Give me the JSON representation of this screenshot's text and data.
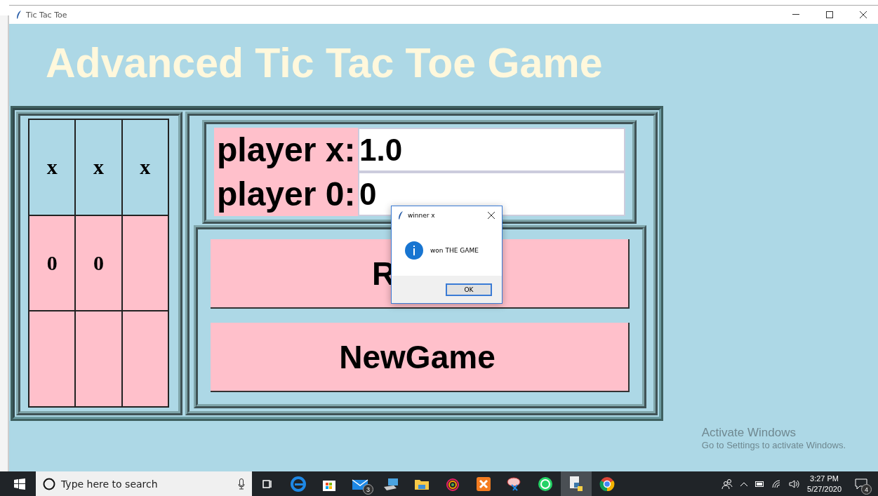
{
  "window": {
    "title": "Tic Tac Toe"
  },
  "heading": "Advanced Tic Tac Toe Game",
  "board": {
    "rows": [
      {
        "cells": [
          {
            "mark": "x",
            "highlighted": true
          },
          {
            "mark": "x",
            "highlighted": true
          },
          {
            "mark": "x",
            "highlighted": true
          }
        ]
      },
      {
        "cells": [
          {
            "mark": "0",
            "highlighted": false
          },
          {
            "mark": "0",
            "highlighted": false
          },
          {
            "highlighted": false
          }
        ]
      },
      {
        "cells": [
          {
            "highlighted": false
          },
          {
            "highlighted": false
          },
          {
            "highlighted": false
          }
        ]
      }
    ]
  },
  "scores": [
    {
      "label": "player x:",
      "value": "1.0"
    },
    {
      "label": "player 0:",
      "value": "0"
    }
  ],
  "buttons": [
    {
      "label": "R"
    },
    {
      "label": "NewGame"
    }
  ],
  "dialog": {
    "title": "winner x",
    "message": "won THE GAME",
    "button": "OK"
  },
  "watermark": {
    "title": "Activate Windows",
    "subtitle": "Go to Settings to activate Windows."
  },
  "taskbar": {
    "search_placeholder": "Type here to search",
    "apps": [
      {
        "kind": "taskview"
      },
      {
        "kind": "edge"
      },
      {
        "kind": "store"
      },
      {
        "kind": "mail",
        "badge": "3"
      },
      {
        "kind": "computer"
      },
      {
        "kind": "folder"
      },
      {
        "kind": "colorful"
      },
      {
        "kind": "xampp"
      },
      {
        "kind": "snip"
      },
      {
        "kind": "whatsapp"
      },
      {
        "kind": "python",
        "selected": true
      },
      {
        "kind": "chrome"
      }
    ],
    "time": "3:27 PM",
    "date": "5/27/2020",
    "notifications": "4"
  }
}
